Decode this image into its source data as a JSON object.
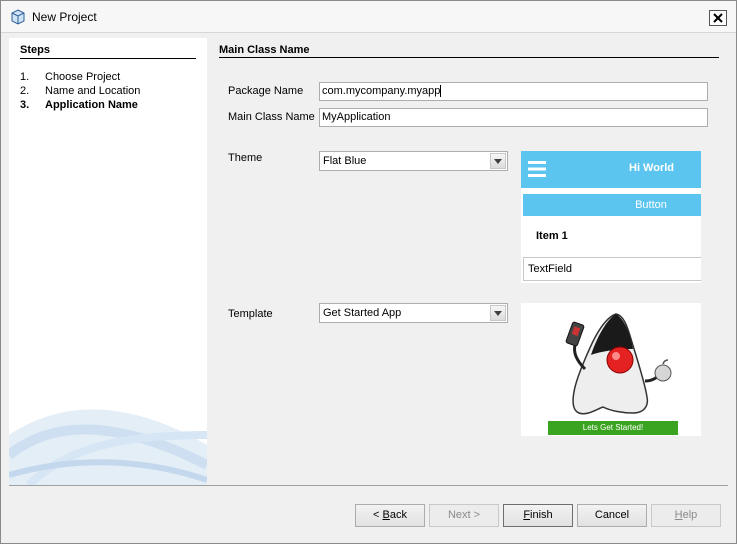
{
  "window": {
    "title": "New Project",
    "title_icon": "cube-icon",
    "close_icon": "close-icon"
  },
  "steps": {
    "title": "Steps",
    "items": [
      {
        "num": "1.",
        "label": "Choose Project",
        "current": false
      },
      {
        "num": "2.",
        "label": "Name and Location",
        "current": false
      },
      {
        "num": "3.",
        "label": "Application Name",
        "current": true
      }
    ]
  },
  "form": {
    "section_title": "Main Class Name",
    "package_label": "Package Name",
    "package_value": "com.mycompany.myapp",
    "main_class_label": "Main Class Name",
    "main_class_value": "MyApplication",
    "theme_label": "Theme",
    "theme_value": "Flat Blue",
    "template_label": "Template",
    "template_value": "Get Started App"
  },
  "theme_preview": {
    "title": "Hi World",
    "button": "Button",
    "item": "Item 1",
    "text_field": "TextField",
    "accent_color": "#5bc5f0"
  },
  "template_preview": {
    "button": "Lets Get Started!",
    "button_color": "#3aa320",
    "image_icon": "duke-mascot-icon"
  },
  "buttons": {
    "back_pre": "< ",
    "back_mn": "B",
    "back_post": "ack",
    "next": "Next >",
    "finish_mn": "F",
    "finish_post": "inish",
    "cancel": "Cancel",
    "help_mn": "H",
    "help_post": "elp"
  }
}
